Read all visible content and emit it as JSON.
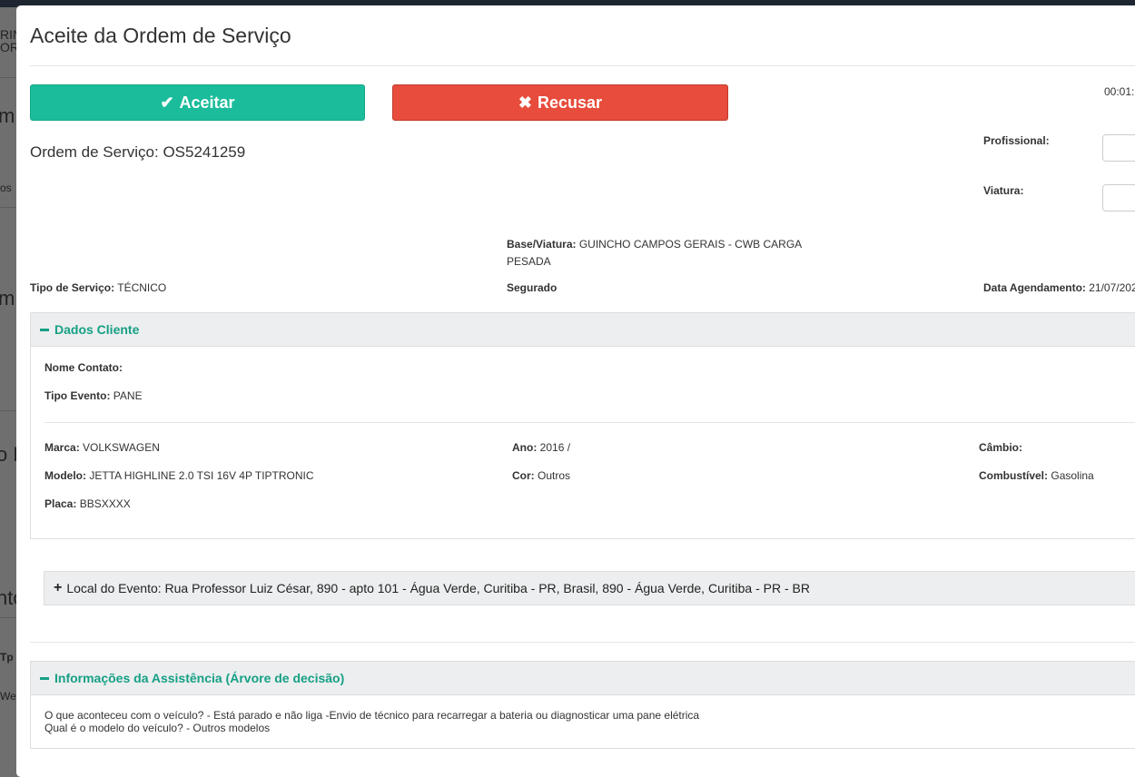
{
  "modal": {
    "title": "Aceite da Ordem de Serviço",
    "accept_label": "Aceitar",
    "reject_label": "Recusar",
    "timer": "00:01:",
    "os_heading": "Ordem de Serviço: OS5241259",
    "profissional_label": "Profissional:",
    "viatura_label": "Viatura:",
    "base_viatura_label": "Base/Viatura:",
    "base_viatura_value": "GUINCHO CAMPOS GERAIS - CWB CARGA",
    "base_viatura_value2": "PESADA",
    "tipo_servico_label": "Tipo de Serviço:",
    "tipo_servico_value": "TÉCNICO",
    "segurado_label": "Segurado",
    "data_agendamento_label": "Data Agendamento:",
    "data_agendamento_value": "21/07/202"
  },
  "dados_cliente": {
    "title": "Dados Cliente",
    "nome_contato_label": "Nome Contato:",
    "tipo_evento_label": "Tipo Evento:",
    "tipo_evento_value": "PANE",
    "marca_label": "Marca:",
    "marca_value": "VOLKSWAGEN",
    "modelo_label": "Modelo:",
    "modelo_value": "JETTA HIGHLINE 2.0 TSI 16V 4P TIPTRONIC",
    "placa_label": "Placa:",
    "placa_value": "BBSXXXX",
    "ano_label": "Ano:",
    "ano_value": "2016 /",
    "cor_label": "Cor:",
    "cor_value": "Outros",
    "cambio_label": "Câmbio:",
    "combustivel_label": "Combustível:",
    "combustivel_value": "Gasolina"
  },
  "local_evento": "Local do Evento: Rua Professor Luiz César, 890 - apto 101 - Água Verde, Curitiba - PR, Brasil, 890 - Água Verde, Curitiba - PR - BR",
  "assistencia": {
    "title": "Informações da Assistência (Árvore de decisão)",
    "line1": "O que aconteceu com o veículo? - Está parado e não liga -Envio de técnico para recarregar a bateria ou diagnosticar uma pane elétrica",
    "line2": "Qual é o modelo do veículo? - Outros modelos"
  },
  "background": {
    "frag1": "m",
    "frag2": "m",
    "frag3": "o L",
    "frag4": "nto",
    "frag5": "Tp A",
    "frag6": "Web",
    "frag7": "os",
    "logo1": "RIN",
    "logo2": "ORA"
  }
}
